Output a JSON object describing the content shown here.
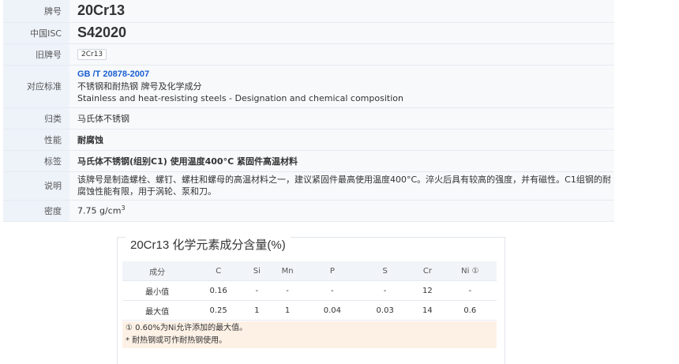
{
  "props": {
    "grade_label": "牌号",
    "grade": "20Cr13",
    "isc_label": "中国ISC",
    "isc": "S42020",
    "old_label": "旧牌号",
    "old": "2Cr13",
    "std_label": "对应标准",
    "std_code": "GB /T 20878-2007",
    "std_cn": "不锈钢和耐热钢 牌号及化学成分",
    "std_en": "Stainless and heat-resisting steels - Designation and chemical composition",
    "class_label": "归类",
    "class": "马氏体不锈钢",
    "perf_label": "性能",
    "perf": "耐腐蚀",
    "tag_label": "标签",
    "tag": "马氏体不锈钢(组别C1)  使用温度400°C  紧固件高温材料",
    "desc_label": "说明",
    "desc": "该牌号是制造螺栓、螺钉、螺柱和螺母的高温材料之一，建议紧固件最高使用温度400°C。淬火后具有较高的强度，并有磁性。C1组钢的耐腐蚀性能有限，用于涡轮、泵和刀。",
    "density_label": "密度",
    "density": "7.75 g/cm",
    "density_sup": "3"
  },
  "chem": {
    "title": "20Cr13 化学元素成分含量(%)",
    "headers": [
      "成分",
      "C",
      "Si",
      "Mn",
      "P",
      "S",
      "Cr",
      "Ni ①"
    ],
    "rows": [
      [
        "最小值",
        "0.16",
        "-",
        "-",
        "-",
        "-",
        "12",
        "-"
      ],
      [
        "最大值",
        "0.25",
        "1",
        "1",
        "0.04",
        "0.03",
        "14",
        "0.6"
      ]
    ],
    "notes": [
      "① 0.60%为Ni允许添加的最大值。",
      "* 耐热钢或可作耐热钢使用。"
    ]
  }
}
